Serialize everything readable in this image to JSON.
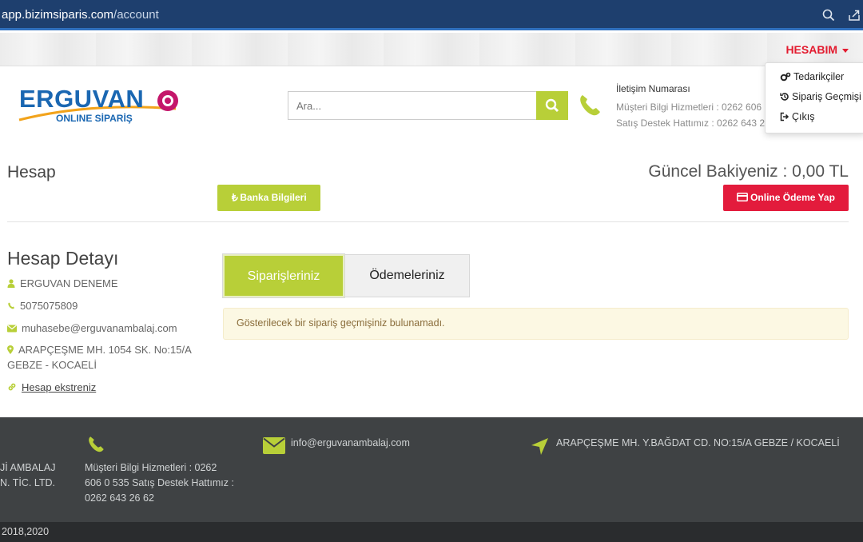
{
  "browser": {
    "url_domain": "app.bizimsiparis.com",
    "url_path": "/account"
  },
  "topbar": {
    "account_label": "HESABIM"
  },
  "dropdown": {
    "items": [
      {
        "label": "Tedarikçiler",
        "icon": "gears-icon"
      },
      {
        "label": "Sipariş Geçmişi",
        "icon": "history-icon"
      },
      {
        "label": "Çıkış",
        "icon": "sign-out-icon"
      }
    ]
  },
  "logo": {
    "brand": "ERGUVAN",
    "tagline": "ONLINE SİPARİŞ"
  },
  "search": {
    "placeholder": "Ara..."
  },
  "contact": {
    "title": "İletişim Numarası",
    "line1": "Müşteri Bilgi Hizmetleri : 0262 606",
    "line2": "Satış Destek Hattımız : 0262 643 2"
  },
  "account": {
    "title": "Hesap",
    "balance": "Güncel Bakiyeniz : 0,00 TL",
    "bank_button": "Banka Bilgileri",
    "pay_button": "Online Ödeme Yap"
  },
  "details": {
    "title": "Hesap Detayı",
    "name": "ERGUVAN DENEME",
    "phone": "5075075809",
    "email": "muhasebe@erguvanambalaj.com",
    "address_line1": "ARAPÇEŞME MH. 1054 SK. No:15/A",
    "address_line2": "GEBZE - KOCAELİ",
    "statement_link": "Hesap ekstreniz"
  },
  "tabs": {
    "orders": "Siparişleriniz",
    "payments": "Ödemeleriniz"
  },
  "alert": {
    "message": "Gösterilecek bir sipariş geçmişiniz bulunamadı."
  },
  "footer": {
    "company_line1": "Jİ AMBALAJ",
    "company_line2": "N. TİC. LTD.",
    "phone_line1": "Müşteri Bilgi Hizmetleri : 0262",
    "phone_line2": "606 0 535 Satış Destek Hattımız :",
    "phone_line3": "0262 643 26 62",
    "email": "info@erguvanambalaj.com",
    "address": "ARAPÇEŞME MH. Y.BAĞDAT CD. NO:15/A GEBZE / KOCAELİ",
    "copyright": "2018,2020"
  },
  "colors": {
    "accent_green": "#b8cf38",
    "accent_red": "#e31b3c",
    "footer_bg": "#3f4244"
  }
}
